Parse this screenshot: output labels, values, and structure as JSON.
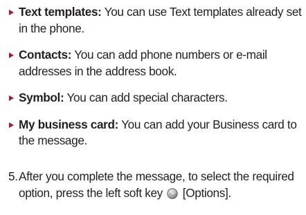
{
  "options": [
    {
      "term": "Text templates:",
      "description": " You can use Text templates already set in the phone."
    },
    {
      "term": "Contacts:",
      "description": " You can add phone numbers or e-mail addresses in the address book."
    },
    {
      "term": "Symbol:",
      "description": " You can add special characters."
    },
    {
      "term": "My business card:",
      "description": " You can add your Business card to the message."
    }
  ],
  "step": {
    "number": "5.",
    "text_before_icon": " After you complete the message, to select the required option, press the left soft key ",
    "icon": "left-soft-key-icon",
    "text_after_icon": " [Options]."
  },
  "colors": {
    "bullet": "#a6192e",
    "text": "#231f20"
  }
}
